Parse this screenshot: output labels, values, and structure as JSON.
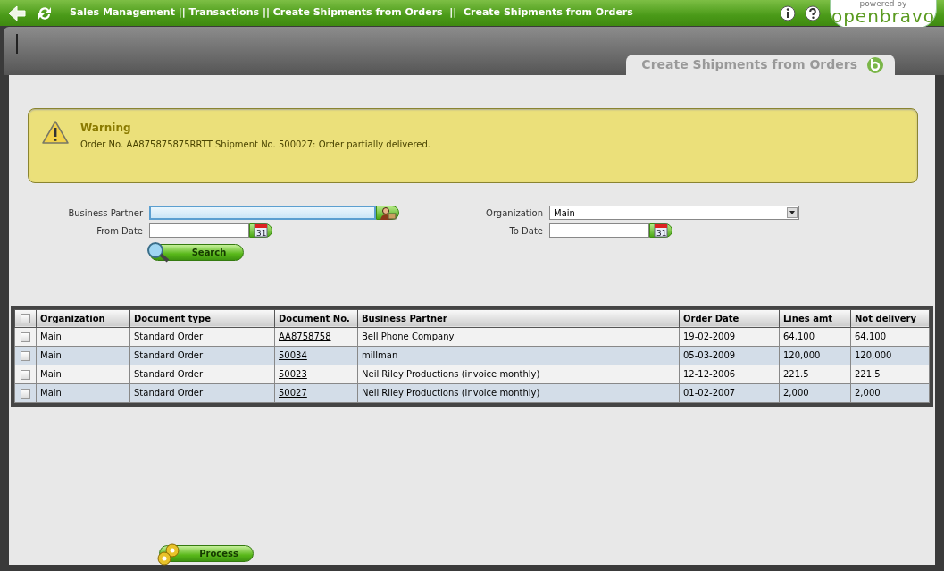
{
  "breadcrumb": "Sales Management || Transactions || Create Shipments from Orders  ||  Create Shipments from Orders",
  "logo": {
    "tagline": "powered by",
    "name": "openbravo"
  },
  "tab": {
    "label": "Create Shipments from Orders"
  },
  "message": {
    "title": "Warning",
    "text": "Order No. AA875875875RRTT Shipment No. 500027: Order partially delivered."
  },
  "filters": {
    "business_partner": {
      "label": "Business Partner"
    },
    "organization": {
      "label": "Organization",
      "value": "Main"
    },
    "from_date": {
      "label": "From Date",
      "calendar_day": "31"
    },
    "to_date": {
      "label": "To Date",
      "calendar_day": "31"
    },
    "search_button": "Search"
  },
  "table": {
    "select_all_checked": false,
    "columns": [
      "Organization",
      "Document type",
      "Document No.",
      "Business Partner",
      "Order Date",
      "Lines amt",
      "Not delivery"
    ],
    "rows": [
      {
        "checked": false,
        "cells": [
          "Main",
          "Standard Order",
          "AA8758758",
          "Bell Phone Company",
          "19-02-2009",
          "64,100",
          "64,100"
        ]
      },
      {
        "checked": false,
        "cells": [
          "Main",
          "Standard Order",
          "50034",
          "millman",
          "05-03-2009",
          "120,000",
          "120,000"
        ]
      },
      {
        "checked": false,
        "cells": [
          "Main",
          "Standard Order",
          "50023",
          "Neil Riley Productions (invoice monthly)",
          "12-12-2006",
          "221.5",
          "221.5"
        ]
      },
      {
        "checked": false,
        "cells": [
          "Main",
          "Standard Order",
          "50027",
          "Neil Riley Productions (invoice monthly)",
          "01-02-2007",
          "2,000",
          "2,000"
        ]
      }
    ]
  },
  "process_button": "Process"
}
